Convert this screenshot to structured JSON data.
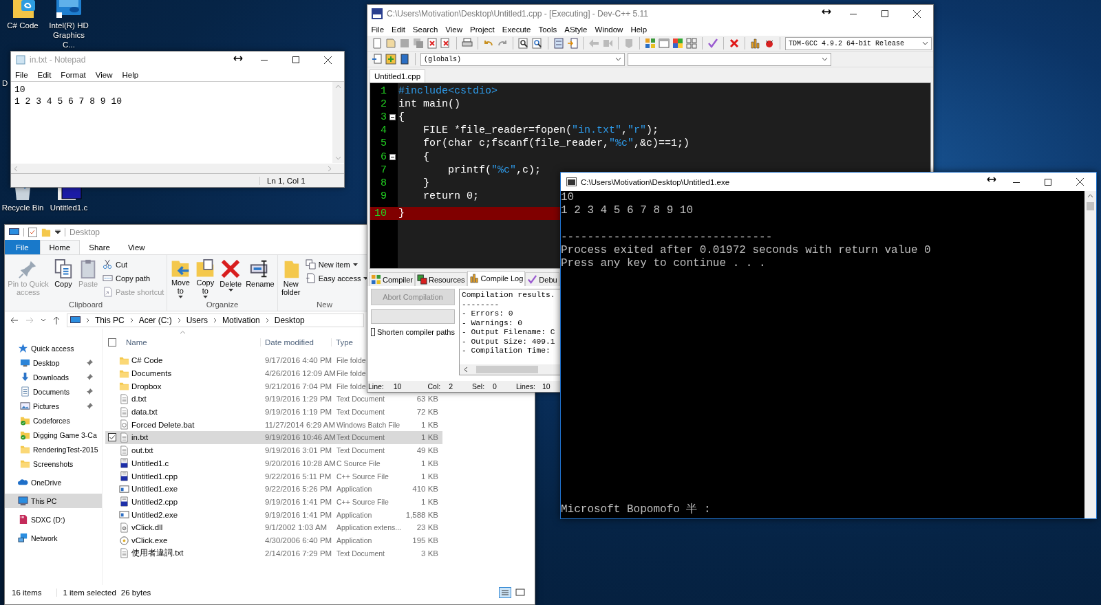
{
  "desktop": {
    "icons": [
      {
        "label": "C# Code",
        "kind": "folder"
      },
      {
        "label": "Intel(R) HD Graphics C...",
        "kind": "intel"
      },
      {
        "label": "D",
        "kind": "hidden"
      },
      {
        "label": "Recycle Bin",
        "kind": "recycle"
      },
      {
        "label": "Untitled1.c",
        "kind": "cfile"
      }
    ]
  },
  "notepad": {
    "title": "in.txt - Notepad",
    "menu": [
      "File",
      "Edit",
      "Format",
      "View",
      "Help"
    ],
    "lines": [
      "10",
      "1 2 3 4 5 6 7 8 9 10"
    ],
    "status": "Ln 1, Col 1"
  },
  "explorer": {
    "title": "Desktop",
    "ribbon_tabs": [
      {
        "label": "File",
        "selected": false,
        "kind": "file"
      },
      {
        "label": "Home",
        "selected": true,
        "kind": "tab"
      },
      {
        "label": "Share",
        "selected": false,
        "kind": "tab"
      },
      {
        "label": "View",
        "selected": false,
        "kind": "tab"
      }
    ],
    "ribbon_groups": [
      {
        "label": "Clipboard",
        "items": [
          {
            "label": "Pin to Quick access",
            "kind": "large",
            "disabled": true,
            "dropdown": false
          },
          {
            "label": "Copy",
            "kind": "large",
            "disabled": false,
            "dropdown": false
          },
          {
            "label": "Paste",
            "kind": "large",
            "disabled": true,
            "dropdown": false
          },
          {
            "label": "Cut",
            "kind": "small",
            "disabled": false,
            "dropdown": false
          },
          {
            "label": "Copy path",
            "kind": "small",
            "disabled": false,
            "dropdown": false
          },
          {
            "label": "Paste shortcut",
            "kind": "small",
            "disabled": true,
            "dropdown": false
          }
        ]
      },
      {
        "label": "Organize",
        "items": [
          {
            "label": "Move to",
            "kind": "large",
            "disabled": false,
            "dropdown": true
          },
          {
            "label": "Copy to",
            "kind": "large",
            "disabled": false,
            "dropdown": true
          },
          {
            "label": "Delete",
            "kind": "large",
            "disabled": false,
            "dropdown": true
          },
          {
            "label": "Rename",
            "kind": "large",
            "disabled": false,
            "dropdown": false
          }
        ]
      },
      {
        "label": "New",
        "items": [
          {
            "label": "New folder",
            "kind": "large",
            "disabled": false,
            "dropdown": false
          },
          {
            "label": "New item",
            "kind": "small",
            "disabled": false,
            "dropdown": true
          },
          {
            "label": "Easy access",
            "kind": "small",
            "disabled": false,
            "dropdown": true
          }
        ]
      }
    ],
    "path": [
      "This PC",
      "Acer (C:)",
      "Users",
      "Motivation",
      "Desktop"
    ],
    "nav": [
      {
        "label": "Quick access",
        "kind": "star",
        "pinned": false,
        "selected": false
      },
      {
        "label": "Desktop",
        "kind": "desktop",
        "pinned": true,
        "selected": false
      },
      {
        "label": "Downloads",
        "kind": "download",
        "pinned": true,
        "selected": false
      },
      {
        "label": "Documents",
        "kind": "documents",
        "pinned": true,
        "selected": false
      },
      {
        "label": "Pictures",
        "kind": "pictures",
        "pinned": true,
        "selected": false
      },
      {
        "label": "Codeforces",
        "kind": "synced",
        "pinned": false,
        "selected": false
      },
      {
        "label": "Digging Game 3-Ca",
        "kind": "synced",
        "pinned": false,
        "selected": false
      },
      {
        "label": "RenderingTest-2015",
        "kind": "folder",
        "pinned": false,
        "selected": false
      },
      {
        "label": "Screenshots",
        "kind": "folder",
        "pinned": false,
        "selected": false
      },
      {
        "label": "OneDrive",
        "kind": "cloud",
        "pinned": false,
        "selected": false
      },
      {
        "label": "This PC",
        "kind": "pc",
        "pinned": false,
        "selected": true
      },
      {
        "label": "SDXC (D:)",
        "kind": "sd",
        "pinned": false,
        "selected": false
      },
      {
        "label": "Network",
        "kind": "network",
        "pinned": false,
        "selected": false
      }
    ],
    "select_all": {
      "checked": false
    },
    "columns": [
      "Name",
      "Date modified",
      "Type"
    ],
    "files": [
      {
        "name": "C# Code",
        "date": "9/17/2016 4:40 PM",
        "type": "File folde",
        "kind": "folder",
        "selected": false
      },
      {
        "name": "Documents",
        "date": "4/26/2016 12:09 AM",
        "type": "File folde",
        "kind": "folder",
        "selected": false
      },
      {
        "name": "Dropbox",
        "date": "9/21/2016 7:04 PM",
        "type": "File folde",
        "kind": "folder",
        "selected": false
      },
      {
        "name": "d.txt",
        "date": "9/19/2016 1:29 PM",
        "type": "Text Document",
        "size": "63 KB",
        "kind": "text",
        "selected": false
      },
      {
        "name": "data.txt",
        "date": "9/19/2016 1:19 PM",
        "type": "Text Document",
        "size": "72 KB",
        "kind": "text",
        "selected": false
      },
      {
        "name": "Forced Delete.bat",
        "date": "11/27/2014 6:29 AM",
        "type": "Windows Batch File",
        "size": "1 KB",
        "kind": "batch",
        "selected": false
      },
      {
        "name": "in.txt",
        "date": "9/19/2016 10:46 AM",
        "type": "Text Document",
        "size": "1 KB",
        "kind": "text",
        "selected": true
      },
      {
        "name": "out.txt",
        "date": "9/19/2016 3:01 PM",
        "type": "Text Document",
        "size": "49 KB",
        "kind": "text",
        "selected": false
      },
      {
        "name": "Untitled1.c",
        "date": "9/20/2016 10:28 AM",
        "type": "C Source File",
        "size": "1 KB",
        "kind": "source",
        "selected": false
      },
      {
        "name": "Untitled1.cpp",
        "date": "9/22/2016 5:11 PM",
        "type": "C++ Source File",
        "size": "1 KB",
        "kind": "source",
        "selected": false
      },
      {
        "name": "Untitled1.exe",
        "date": "9/22/2016 5:26 PM",
        "type": "Application",
        "size": "410 KB",
        "kind": "app",
        "selected": false
      },
      {
        "name": "Untitled2.cpp",
        "date": "9/19/2016 1:41 PM",
        "type": "C++ Source File",
        "size": "1 KB",
        "kind": "source",
        "selected": false
      },
      {
        "name": "Untitled2.exe",
        "date": "9/19/2016 1:41 PM",
        "type": "Application",
        "size": "1,588 KB",
        "kind": "app",
        "selected": false
      },
      {
        "name": "vClick.dll",
        "date": "9/1/2002 1:03 AM",
        "type": "Application extens...",
        "size": "23 KB",
        "kind": "dll",
        "selected": false
      },
      {
        "name": "vClick.exe",
        "date": "4/30/2006 6:40 PM",
        "type": "Application",
        "size": "195 KB",
        "kind": "setup",
        "selected": false
      },
      {
        "name": "使用者違詞.txt",
        "date": "2/14/2016 7:29 PM",
        "type": "Text Document",
        "size": "3 KB",
        "kind": "text",
        "selected": false
      }
    ],
    "status": [
      "16 items",
      "1 item selected",
      "26 bytes"
    ]
  },
  "devcpp": {
    "title": "C:\\Users\\Motivation\\Desktop\\Untitled1.cpp - [Executing] - Dev-C++ 5.11",
    "menu": [
      "File",
      "Edit",
      "Search",
      "View",
      "Project",
      "Execute",
      "Tools",
      "AStyle",
      "Window",
      "Help"
    ],
    "compiler": "TDM-GCC 4.9.2 64-bit Release",
    "scope": "(globals)",
    "file_tabs": [
      {
        "label": "Untitled1.cpp",
        "selected": true
      }
    ],
    "code": [
      {
        "number": "1",
        "fold": false,
        "selected": false,
        "tokens": [
          {
            "text": "#include<cstdio>",
            "kind": "directive"
          }
        ]
      },
      {
        "number": "2",
        "fold": false,
        "selected": false,
        "tokens": [
          {
            "text": "int main()",
            "kind": "plain"
          }
        ]
      },
      {
        "number": "3",
        "fold": true,
        "selected": false,
        "tokens": [
          {
            "text": "{",
            "kind": "plain"
          }
        ]
      },
      {
        "number": "4",
        "fold": false,
        "selected": false,
        "tokens": [
          {
            "text": "    FILE *file_reader=fopen(",
            "kind": "plain"
          },
          {
            "text": "\"in.txt\"",
            "kind": "string"
          },
          {
            "text": ",",
            "kind": "plain"
          },
          {
            "text": "\"r\"",
            "kind": "string"
          },
          {
            "text": ");",
            "kind": "plain"
          }
        ]
      },
      {
        "number": "5",
        "fold": false,
        "selected": false,
        "tokens": [
          {
            "text": "    for(char c;fscanf(file_reader,",
            "kind": "plain"
          },
          {
            "text": "\"%c\"",
            "kind": "string"
          },
          {
            "text": ",&c)==1;)",
            "kind": "plain"
          }
        ]
      },
      {
        "number": "6",
        "fold": true,
        "selected": false,
        "tokens": [
          {
            "text": "    {",
            "kind": "plain"
          }
        ]
      },
      {
        "number": "7",
        "fold": false,
        "selected": false,
        "tokens": [
          {
            "text": "        printf(",
            "kind": "plain"
          },
          {
            "text": "\"%c\"",
            "kind": "string"
          },
          {
            "text": ",c);",
            "kind": "plain"
          }
        ]
      },
      {
        "number": "8",
        "fold": false,
        "selected": false,
        "tokens": [
          {
            "text": "    }",
            "kind": "plain"
          }
        ]
      },
      {
        "number": "9",
        "fold": false,
        "selected": false,
        "tokens": [
          {
            "text": "    return 0;",
            "kind": "plain"
          }
        ]
      },
      {
        "number": "10",
        "fold": false,
        "selected": true,
        "tokens": [
          {
            "text": "}",
            "kind": "plain"
          }
        ]
      }
    ],
    "bottom_tabs": [
      {
        "label": "Compiler",
        "selected": false,
        "kind": "grid"
      },
      {
        "label": "Resources",
        "selected": false,
        "kind": "layers"
      },
      {
        "label": "Compile Log",
        "selected": true,
        "kind": "chart"
      },
      {
        "label": "Debu",
        "selected": false,
        "kind": "check"
      }
    ],
    "abort": {
      "label": "Abort Compilation",
      "disabled": true
    },
    "shorten": {
      "label": "Shorten compiler paths",
      "checked": false
    },
    "log": [
      "Compilation results.",
      "--------",
      "- Errors: 0",
      "- Warnings: 0",
      "- Output Filename: C",
      "- Output Size: 409.1",
      "- Compilation Time:"
    ],
    "status": [
      {
        "label": "Line:",
        "value": "10"
      },
      {
        "label": "Col:",
        "value": "2"
      },
      {
        "label": "Sel:",
        "value": "0"
      },
      {
        "label": "Lines:",
        "value": "10"
      }
    ]
  },
  "console": {
    "title": "C:\\Users\\Motivation\\Desktop\\Untitled1.exe",
    "lines": [
      {
        "text": "10",
        "blank_before": false
      },
      {
        "text": "1 2 3 4 5 6 7 8 9 10",
        "blank_before": false
      },
      {
        "text": "--------------------------------",
        "blank_before": true
      },
      {
        "text": "Process exited after 0.01972 seconds with return value 0",
        "blank_before": false
      },
      {
        "text": "Press any key to continue . . .",
        "blank_before": false
      }
    ],
    "ime": "Microsoft Bopomofo 半 :"
  }
}
